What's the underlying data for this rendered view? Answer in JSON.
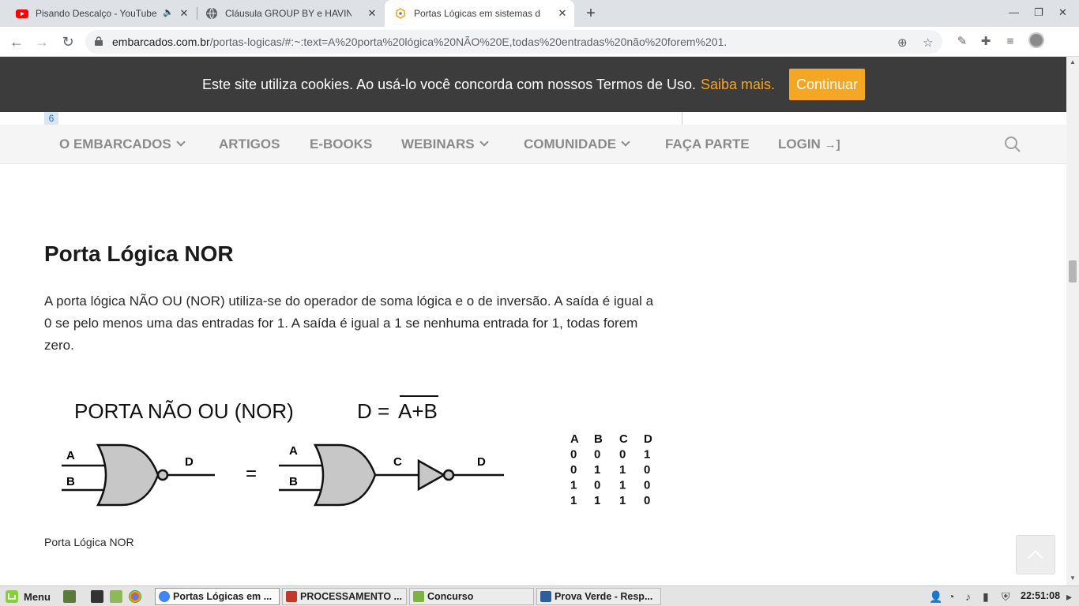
{
  "browser": {
    "tabs": [
      {
        "title": "Pisando Descalço - YouTube",
        "icon": "youtube-icon",
        "active": false
      },
      {
        "title": "Cláusula GROUP BY e HAVING em",
        "icon": "globe-icon",
        "active": false
      },
      {
        "title": "Portas Lógicas em sistemas digitais",
        "icon": "embarcados-icon",
        "active": true
      }
    ],
    "url_host": "embarcados.com.br",
    "url_path": "/portas-logicas/#:~:text=A%20porta%20lógica%20NÃO%20E,todas%20entradas%20não%20forem%201."
  },
  "cookie": {
    "text": "Este site utiliza cookies. Ao usá-lo você concorda com nossos Termos de Uso.",
    "link": "Saiba mais.",
    "button": "Continuar"
  },
  "peek": {
    "number": "6"
  },
  "nav": {
    "items": [
      {
        "label": "O EMBARCADOS",
        "dropdown": true
      },
      {
        "label": "ARTIGOS",
        "dropdown": false
      },
      {
        "label": "E-BOOKS",
        "dropdown": false
      },
      {
        "label": "WEBINARS",
        "dropdown": true
      },
      {
        "label": "COMUNIDADE",
        "dropdown": true
      },
      {
        "label": "FAÇA PARTE",
        "dropdown": false
      },
      {
        "label": "LOGIN",
        "dropdown": false
      }
    ],
    "login_icon": "→]"
  },
  "article": {
    "heading": "Porta Lógica NOR",
    "paragraph_lines": [
      "A porta lógica NÃO OU (NOR) utiliza-se do operador de soma lógica e o de inversão. A saída é igual a",
      "0 se pelo menos uma das entradas for 1. A saída é igual a 1 se nenhuma entrada for 1, todas forem",
      "zero."
    ],
    "figure": {
      "title": "PORTA NÃO OU (NOR)",
      "eq_lhs": "D = ",
      "eq_rhs": "A+B",
      "labels": {
        "a": "A",
        "b": "B",
        "c": "C",
        "d": "D",
        "equals": "="
      },
      "truth_table": {
        "headers": [
          "A",
          "B",
          "C",
          "D"
        ],
        "rows": [
          [
            "0",
            "0",
            "0",
            "1"
          ],
          [
            "0",
            "1",
            "1",
            "0"
          ],
          [
            "1",
            "0",
            "1",
            "0"
          ],
          [
            "1",
            "1",
            "1",
            "0"
          ]
        ]
      }
    },
    "caption": "Porta Lógica NOR"
  },
  "taskbar": {
    "menu": "Menu",
    "windows": [
      {
        "label": "Portas Lógicas em ...",
        "active": true,
        "color": "#4285f4"
      },
      {
        "label": "PROCESSAMENTO ...",
        "active": false,
        "color": "#c0392b"
      },
      {
        "label": "Concurso",
        "active": false,
        "color": "#7cb342"
      },
      {
        "label": "Prova Verde - Resp...",
        "active": false,
        "color": "#2c5f9e"
      }
    ],
    "clock": "22:51:08"
  }
}
